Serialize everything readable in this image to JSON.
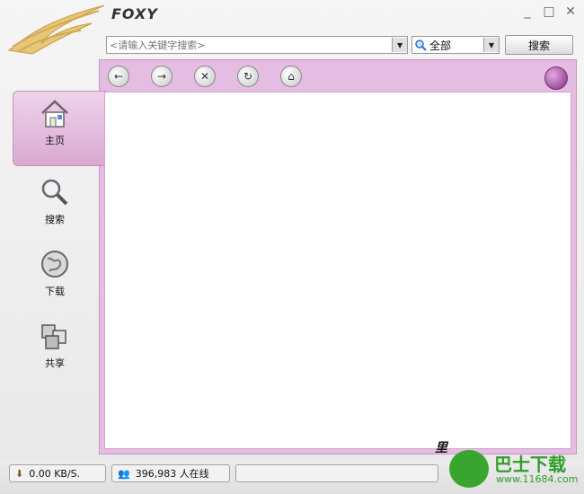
{
  "app": {
    "brand": "FOXY"
  },
  "window_controls": {
    "minimize": "_",
    "maximize": "□",
    "close": "✕"
  },
  "search": {
    "placeholder": "<请输入关键字搜索>",
    "scope_selected": "全部",
    "button_label": "搜索"
  },
  "sidebar": {
    "items": [
      {
        "label": "主页",
        "icon": "home-icon",
        "active": true
      },
      {
        "label": "搜索",
        "icon": "magnifier-icon",
        "active": false
      },
      {
        "label": "下载",
        "icon": "globe-download-icon",
        "active": false
      },
      {
        "label": "共享",
        "icon": "share-cubes-icon",
        "active": false
      }
    ]
  },
  "toolbar": {
    "buttons": [
      {
        "name": "back",
        "glyph": "←"
      },
      {
        "name": "forward",
        "glyph": "→"
      },
      {
        "name": "stop",
        "glyph": "✕"
      },
      {
        "name": "refresh",
        "glyph": "↻"
      },
      {
        "name": "home",
        "glyph": "⌂"
      }
    ]
  },
  "status": {
    "speed": "0.00 KB/S.",
    "online": "396,983 人在线"
  },
  "watermark": {
    "text": "里",
    "site_title": "巴士下载",
    "site_url": "www.11684.com"
  },
  "colors": {
    "accent": "#e6bde2",
    "watermark_green": "#2e9e2a"
  }
}
